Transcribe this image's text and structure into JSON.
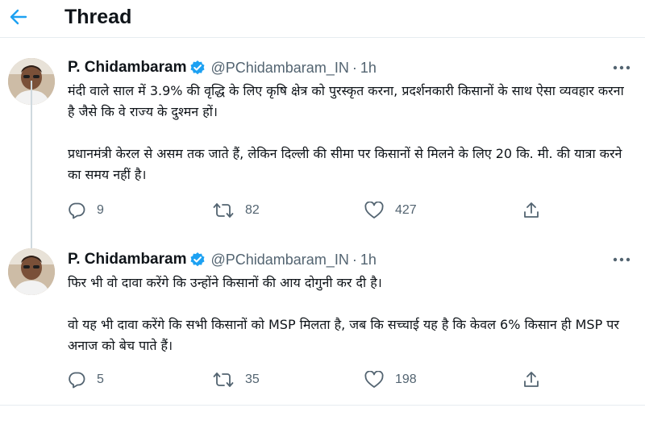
{
  "header": {
    "back_icon": "arrow-left-icon",
    "title": "Thread"
  },
  "colors": {
    "accent": "#1da1f2",
    "text_primary": "#0f1419",
    "text_secondary": "#536471",
    "divider": "#e6ecf0"
  },
  "tweets": [
    {
      "author_name": "P. Chidambaram",
      "verified_icon": "verified-badge-icon",
      "handle": "@PChidambaram_IN",
      "separator": "·",
      "time": "1h",
      "paragraphs": [
        "मंदी वाले साल में 3.9% की वृद्धि के लिए कृषि क्षेत्र को पुरस्कृत करना, प्रदर्शनकारी किसानों के साथ ऐसा व्यवहार करना है जैसे कि वे राज्य के दुश्मन हों।",
        "प्रधानमंत्री केरल से असम तक जाते हैं, लेकिन दिल्ली की सीमा पर किसानों से मिलने के लिए 20 कि. मी. की यात्रा करने का समय नहीं है।"
      ],
      "replies": "9",
      "retweets": "82",
      "likes": "427"
    },
    {
      "author_name": "P. Chidambaram",
      "verified_icon": "verified-badge-icon",
      "handle": "@PChidambaram_IN",
      "separator": "·",
      "time": "1h",
      "paragraphs": [
        "फिर भी वो दावा करेंगे कि उन्होंने किसानों की आय दोगुनी कर दी है।",
        "वो यह भी दावा करेंगे कि सभी किसानों को MSP मिलता है, जब कि सच्चाई यह है कि केवल 6% किसान ही MSP पर अनाज को बेच पाते हैं।"
      ],
      "replies": "5",
      "retweets": "35",
      "likes": "198"
    }
  ]
}
